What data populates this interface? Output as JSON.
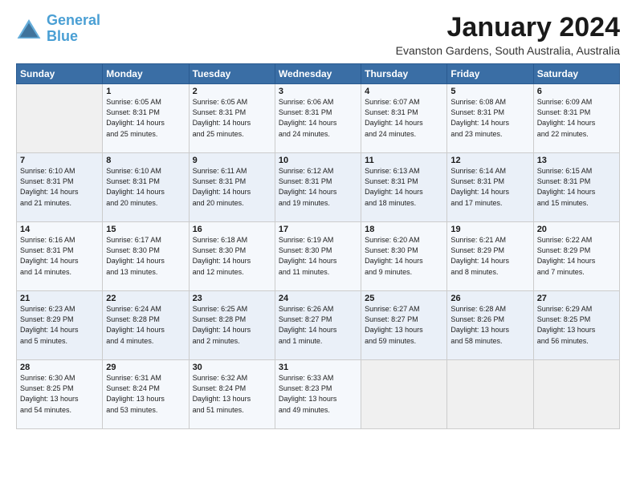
{
  "logo": {
    "line1": "General",
    "line2": "Blue"
  },
  "title": "January 2024",
  "subtitle": "Evanston Gardens, South Australia, Australia",
  "days_header": [
    "Sunday",
    "Monday",
    "Tuesday",
    "Wednesday",
    "Thursday",
    "Friday",
    "Saturday"
  ],
  "weeks": [
    [
      {
        "day": "",
        "info": ""
      },
      {
        "day": "1",
        "info": "Sunrise: 6:05 AM\nSunset: 8:31 PM\nDaylight: 14 hours\nand 25 minutes."
      },
      {
        "day": "2",
        "info": "Sunrise: 6:05 AM\nSunset: 8:31 PM\nDaylight: 14 hours\nand 25 minutes."
      },
      {
        "day": "3",
        "info": "Sunrise: 6:06 AM\nSunset: 8:31 PM\nDaylight: 14 hours\nand 24 minutes."
      },
      {
        "day": "4",
        "info": "Sunrise: 6:07 AM\nSunset: 8:31 PM\nDaylight: 14 hours\nand 24 minutes."
      },
      {
        "day": "5",
        "info": "Sunrise: 6:08 AM\nSunset: 8:31 PM\nDaylight: 14 hours\nand 23 minutes."
      },
      {
        "day": "6",
        "info": "Sunrise: 6:09 AM\nSunset: 8:31 PM\nDaylight: 14 hours\nand 22 minutes."
      }
    ],
    [
      {
        "day": "7",
        "info": "Sunrise: 6:10 AM\nSunset: 8:31 PM\nDaylight: 14 hours\nand 21 minutes."
      },
      {
        "day": "8",
        "info": "Sunrise: 6:10 AM\nSunset: 8:31 PM\nDaylight: 14 hours\nand 20 minutes."
      },
      {
        "day": "9",
        "info": "Sunrise: 6:11 AM\nSunset: 8:31 PM\nDaylight: 14 hours\nand 20 minutes."
      },
      {
        "day": "10",
        "info": "Sunrise: 6:12 AM\nSunset: 8:31 PM\nDaylight: 14 hours\nand 19 minutes."
      },
      {
        "day": "11",
        "info": "Sunrise: 6:13 AM\nSunset: 8:31 PM\nDaylight: 14 hours\nand 18 minutes."
      },
      {
        "day": "12",
        "info": "Sunrise: 6:14 AM\nSunset: 8:31 PM\nDaylight: 14 hours\nand 17 minutes."
      },
      {
        "day": "13",
        "info": "Sunrise: 6:15 AM\nSunset: 8:31 PM\nDaylight: 14 hours\nand 15 minutes."
      }
    ],
    [
      {
        "day": "14",
        "info": "Sunrise: 6:16 AM\nSunset: 8:31 PM\nDaylight: 14 hours\nand 14 minutes."
      },
      {
        "day": "15",
        "info": "Sunrise: 6:17 AM\nSunset: 8:30 PM\nDaylight: 14 hours\nand 13 minutes."
      },
      {
        "day": "16",
        "info": "Sunrise: 6:18 AM\nSunset: 8:30 PM\nDaylight: 14 hours\nand 12 minutes."
      },
      {
        "day": "17",
        "info": "Sunrise: 6:19 AM\nSunset: 8:30 PM\nDaylight: 14 hours\nand 11 minutes."
      },
      {
        "day": "18",
        "info": "Sunrise: 6:20 AM\nSunset: 8:30 PM\nDaylight: 14 hours\nand 9 minutes."
      },
      {
        "day": "19",
        "info": "Sunrise: 6:21 AM\nSunset: 8:29 PM\nDaylight: 14 hours\nand 8 minutes."
      },
      {
        "day": "20",
        "info": "Sunrise: 6:22 AM\nSunset: 8:29 PM\nDaylight: 14 hours\nand 7 minutes."
      }
    ],
    [
      {
        "day": "21",
        "info": "Sunrise: 6:23 AM\nSunset: 8:29 PM\nDaylight: 14 hours\nand 5 minutes."
      },
      {
        "day": "22",
        "info": "Sunrise: 6:24 AM\nSunset: 8:28 PM\nDaylight: 14 hours\nand 4 minutes."
      },
      {
        "day": "23",
        "info": "Sunrise: 6:25 AM\nSunset: 8:28 PM\nDaylight: 14 hours\nand 2 minutes."
      },
      {
        "day": "24",
        "info": "Sunrise: 6:26 AM\nSunset: 8:27 PM\nDaylight: 14 hours\nand 1 minute."
      },
      {
        "day": "25",
        "info": "Sunrise: 6:27 AM\nSunset: 8:27 PM\nDaylight: 13 hours\nand 59 minutes."
      },
      {
        "day": "26",
        "info": "Sunrise: 6:28 AM\nSunset: 8:26 PM\nDaylight: 13 hours\nand 58 minutes."
      },
      {
        "day": "27",
        "info": "Sunrise: 6:29 AM\nSunset: 8:25 PM\nDaylight: 13 hours\nand 56 minutes."
      }
    ],
    [
      {
        "day": "28",
        "info": "Sunrise: 6:30 AM\nSunset: 8:25 PM\nDaylight: 13 hours\nand 54 minutes."
      },
      {
        "day": "29",
        "info": "Sunrise: 6:31 AM\nSunset: 8:24 PM\nDaylight: 13 hours\nand 53 minutes."
      },
      {
        "day": "30",
        "info": "Sunrise: 6:32 AM\nSunset: 8:24 PM\nDaylight: 13 hours\nand 51 minutes."
      },
      {
        "day": "31",
        "info": "Sunrise: 6:33 AM\nSunset: 8:23 PM\nDaylight: 13 hours\nand 49 minutes."
      },
      {
        "day": "",
        "info": ""
      },
      {
        "day": "",
        "info": ""
      },
      {
        "day": "",
        "info": ""
      }
    ]
  ]
}
